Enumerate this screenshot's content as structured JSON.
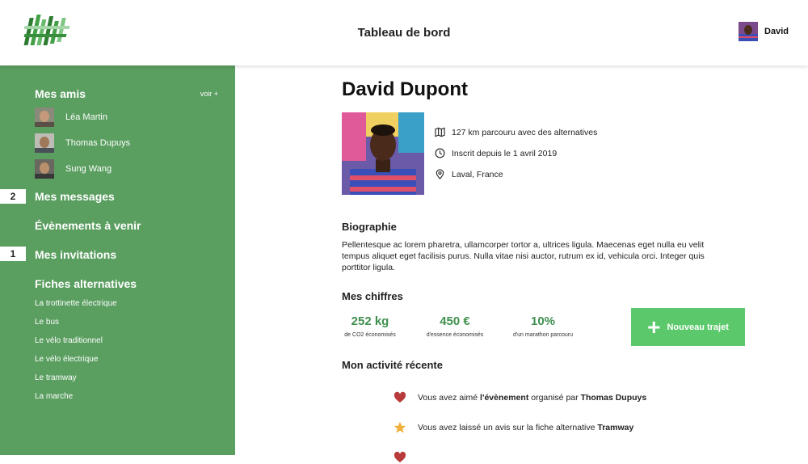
{
  "header": {
    "title": "Tableau de bord",
    "user_name": "David"
  },
  "sidebar": {
    "friends_title": "Mes amis",
    "see_more": "voir +",
    "friends": [
      {
        "name": "Léa Martin"
      },
      {
        "name": "Thomas Dupuys"
      },
      {
        "name": "Sung Wang"
      }
    ],
    "messages_title": "Mes messages",
    "messages_badge": "2",
    "events_title": "Évènements à venir",
    "invitations_title": "Mes invitations",
    "invitations_badge": "1",
    "alternatives_title": "Fiches alternatives",
    "alternatives": [
      {
        "label": "La trottinette électrique"
      },
      {
        "label": "Le bus"
      },
      {
        "label": "Le vélo traditionnel"
      },
      {
        "label": "Le vélo électrique"
      },
      {
        "label": "Le tramway"
      },
      {
        "label": "La marche"
      }
    ]
  },
  "profile": {
    "name": "David Dupont",
    "distance": "127 km parcouru avec des alternatives",
    "member_since": "Inscrit depuis le 1 avril 2019",
    "location": "Laval, France"
  },
  "bio": {
    "title": "Biographie",
    "text": "Pellentesque ac lorem pharetra,  ullamcorper tortor a, ultrices ligula. Maecenas eget nulla eu velit tempus aliquet eget facilisis purus. Nulla vitae nisi auctor, rutrum ex id, vehicula orci. Integer quis porttitor ligula."
  },
  "stats": {
    "title": "Mes chiffres",
    "items": [
      {
        "value": "252 kg",
        "label": "de CO2 économisés"
      },
      {
        "value": "450 €",
        "label": "d'essence économisés"
      },
      {
        "value": "10%",
        "label": "d'un marathon parcouru"
      }
    ],
    "new_trip_label": "Nouveau trajet"
  },
  "activity": {
    "title": "Mon activité récente",
    "items": [
      {
        "prefix": "Vous avez aimé ",
        "strong1": "l'évènement",
        "middle": " organisé par ",
        "strong2": "Thomas Dupuys"
      },
      {
        "prefix": "Vous avez laissé un avis sur la fiche alternative ",
        "strong1": "Tramway",
        "middle": "",
        "strong2": ""
      }
    ]
  },
  "colors": {
    "sidebar": "#5a9e60",
    "accent_green": "#3f8f4f",
    "button_green": "#5bc96b",
    "heart": "#b83a3a",
    "star": "#f0b03c"
  },
  "icons": {
    "map": "map-icon",
    "clock": "clock-icon",
    "pin": "location-pin-icon",
    "heart": "heart-icon",
    "star": "star-icon",
    "plus": "plus-icon"
  }
}
